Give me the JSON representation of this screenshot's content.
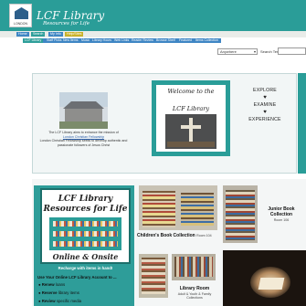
{
  "header": {
    "logo_text": "LONDON",
    "title": "LCF Library",
    "subtitle": "Resources for Life"
  },
  "nav_primary": [
    {
      "label": "Home",
      "color": "#3f86c4"
    },
    {
      "label": "Search",
      "color": "#2e9f9a"
    },
    {
      "label": "My Info",
      "color": "#3f86c4"
    },
    {
      "label": "Help/Sites",
      "color": "#c9b22a"
    }
  ],
  "nav_secondary": [
    "LCF Library",
    "Staff Picks",
    "New Items",
    "Music",
    "Library Hours",
    "Web Links",
    "Reader Review",
    "Browse Shelf",
    "Featured",
    "Items Collection"
  ],
  "search": {
    "scope_value": "Anywhere",
    "label": "Search Terms"
  },
  "intro": {
    "caption_line1": "The LCF Library aims to enhance the mission of",
    "caption_link": "London Christian Fellowship",
    "caption_line2": "London Christian Fellowship seeks to develop authentic and passionate followers of Jesus Christ",
    "welcome_title": "Welcome to the",
    "welcome_subtitle": "LCF Library",
    "words": [
      "EXPLORE",
      "EXAMINE",
      "EXPERIENCE"
    ],
    "heart_glyph": "♥"
  },
  "promo": {
    "title_line1": "LCF Library",
    "title_line2": "Resources for Life",
    "title_line3": "Online & Onsite",
    "recharge": "Recharge with items in hand!",
    "use_heading": "Use Your Online LCF Library Account to ...",
    "bullets": [
      {
        "verb": "Renew",
        "rest": "loans"
      },
      {
        "verb": "Reserve",
        "rest": "library items"
      },
      {
        "verb": "Review",
        "rest": "specific media"
      }
    ]
  },
  "collections": [
    {
      "title": "Children's Book Collection",
      "room": "Room 104"
    },
    {
      "title": "Junior Book Collection",
      "room": "Room 106"
    },
    {
      "title": "Library Room",
      "sub": "Adult & Youth & Family Collections"
    }
  ],
  "colors": {
    "brand_teal": "#2a9d98",
    "nav_blue": "#3f86c4",
    "link_blue": "#2d5fa8"
  }
}
